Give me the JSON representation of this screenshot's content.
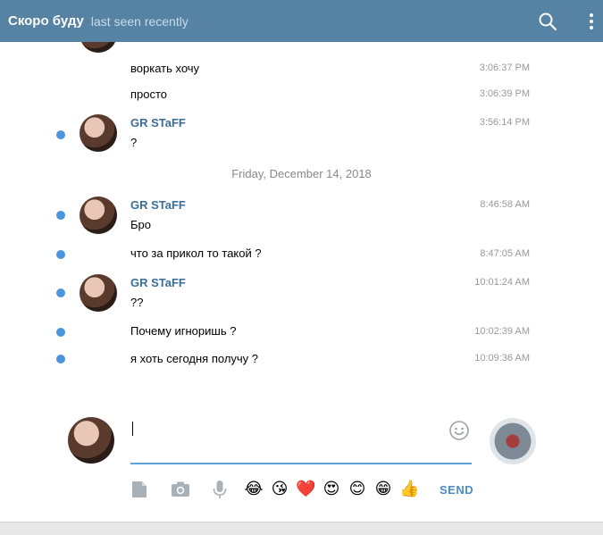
{
  "header": {
    "title": "Скоро буду",
    "status": "last seen recently",
    "color": "#5682a3"
  },
  "messages": [
    {
      "text": "воркать хочу",
      "time": "3:06:37 PM"
    },
    {
      "text": "просто",
      "time": "3:06:39 PM"
    },
    {
      "name": "GR STaFF",
      "text": "?",
      "time": "3:56:14 PM"
    },
    {
      "date_separator": "Friday, December 14, 2018"
    },
    {
      "name": "GR STaFF",
      "text": "Бро",
      "time": "8:46:58 AM"
    },
    {
      "text": "что за прикол то такой ?",
      "time": "8:47:05 AM"
    },
    {
      "name": "GR STaFF",
      "text": "??",
      "time": "10:01:24 AM"
    },
    {
      "text": "Почему игноришь ?",
      "time": "10:02:39 AM"
    },
    {
      "text": "я хоть сегодня получу ?",
      "time": "10:09:36 AM"
    }
  ],
  "composer": {
    "input_value": "",
    "send_label": "SEND",
    "stickers": [
      "😂",
      "😘",
      "❤️",
      "😍",
      "😊",
      "😁",
      "👍"
    ]
  },
  "icons": {
    "header": [
      "search-icon",
      "more-vertical-icon"
    ],
    "composer": [
      "emoji-icon",
      "document-icon",
      "camera-icon",
      "microphone-icon"
    ]
  },
  "colors": {
    "accent": "#5682a3",
    "name": "#3a6d99",
    "unread": "#4a95dd",
    "send": "#4a8bc9"
  }
}
